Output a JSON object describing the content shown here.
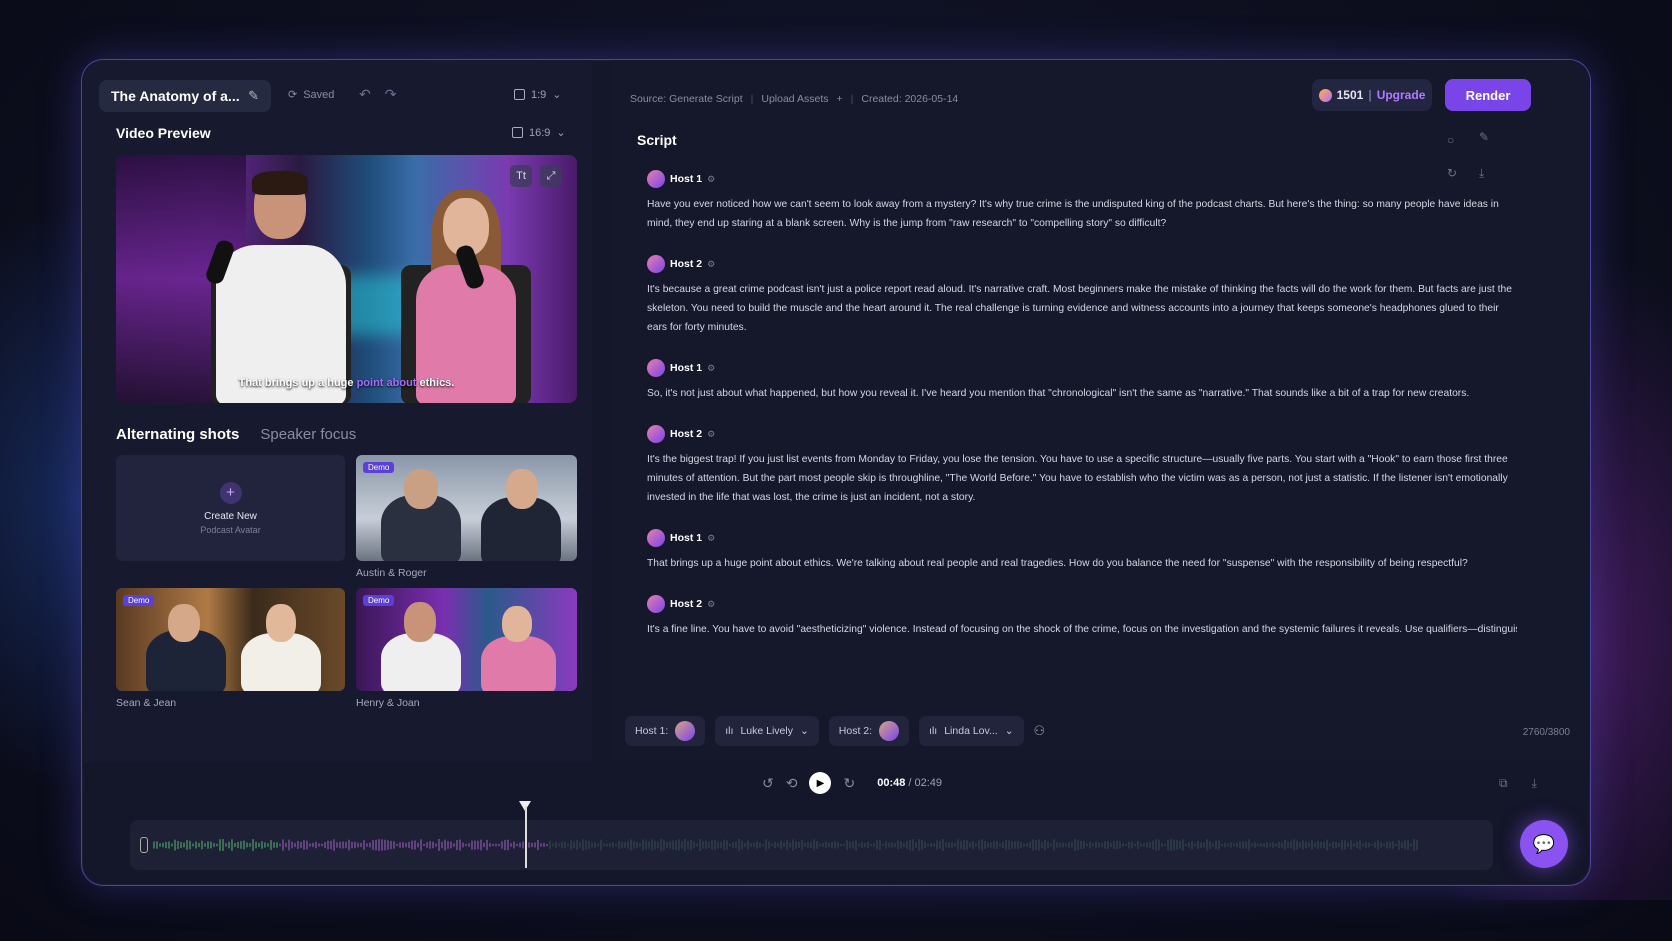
{
  "header": {
    "project_title": "The Anatomy of a...",
    "saved_label": "Saved",
    "aspect_label": "1:9"
  },
  "preview": {
    "title": "Video Preview",
    "aspect_label": "16:9",
    "caption_pre": "That brings up a huge ",
    "caption_highlight": "point about",
    "caption_post": " ethics."
  },
  "shots": {
    "tab_active": "Alternating shots",
    "tab_inactive": "Speaker focus",
    "create_title": "Create New",
    "create_sub": "Podcast Avatar",
    "demo_badge": "Demo",
    "items": [
      {
        "label": "Austin & Roger"
      },
      {
        "label": "Sean & Jean"
      },
      {
        "label": "Henry & Joan"
      }
    ]
  },
  "topbar": {
    "source": "Source: Generate Script",
    "upload": "Upload Assets",
    "created": "Created: 2026-05-14",
    "credits": "1501",
    "upgrade": "Upgrade",
    "render": "Render"
  },
  "script": {
    "title": "Script",
    "blocks": [
      {
        "speaker": "Host 1",
        "text": "Have you ever noticed how we can't seem to look away from a mystery? It's why true crime is the undisputed king of the podcast charts. But here's the thing: so many people have ideas in mind, they end up staring at a blank screen. Why is the jump from \"raw research\" to \"compelling story\" so difficult?"
      },
      {
        "speaker": "Host 2",
        "text": "It's because a great crime podcast isn't just a police report read aloud. It's narrative craft. Most beginners make the mistake of thinking the facts will do the work for them. But facts are just the skeleton. You need to build the muscle and the heart around it. The real challenge is turning evidence and witness accounts into a journey that keeps someone's headphones glued to their ears for forty minutes."
      },
      {
        "speaker": "Host 1",
        "text": "So, it's not just about what happened, but how you reveal it. I've heard you mention that \"chronological\" isn't the same as \"narrative.\" That sounds like a bit of a trap for new creators."
      },
      {
        "speaker": "Host 2",
        "text": "It's the biggest trap! If you just list events from Monday to Friday, you lose the tension. You have to use a specific structure—usually five parts. You start with a \"Hook\" to earn those first three minutes of attention. But the part most people skip is throughline, \"The World Before.\" You have to establish who the victim was as a person, not just a statistic. If the listener isn't emotionally invested in the life that was lost, the crime is just an incident, not a story."
      },
      {
        "speaker": "Host 1",
        "text": "That brings up a huge point about ethics. We're talking about real people and real tragedies. How do you balance the need for \"suspense\" with the responsibility of being respectful?"
      },
      {
        "speaker": "Host 2",
        "text": "It's a fine line. You have to avoid \"aestheticizing\" violence. Instead of focusing on the shock of the crime, focus on the investigation and the systemic failures it reveals. Use qualifiers—distinguish"
      }
    ]
  },
  "voices": {
    "host1_label": "Host 1:",
    "host1_voice": "Luke Lively",
    "host2_label": "Host 2:",
    "host2_voice": "Linda Lov...",
    "counter": "2760/3800"
  },
  "player": {
    "current": "00:48",
    "total": "/ 02:49"
  }
}
